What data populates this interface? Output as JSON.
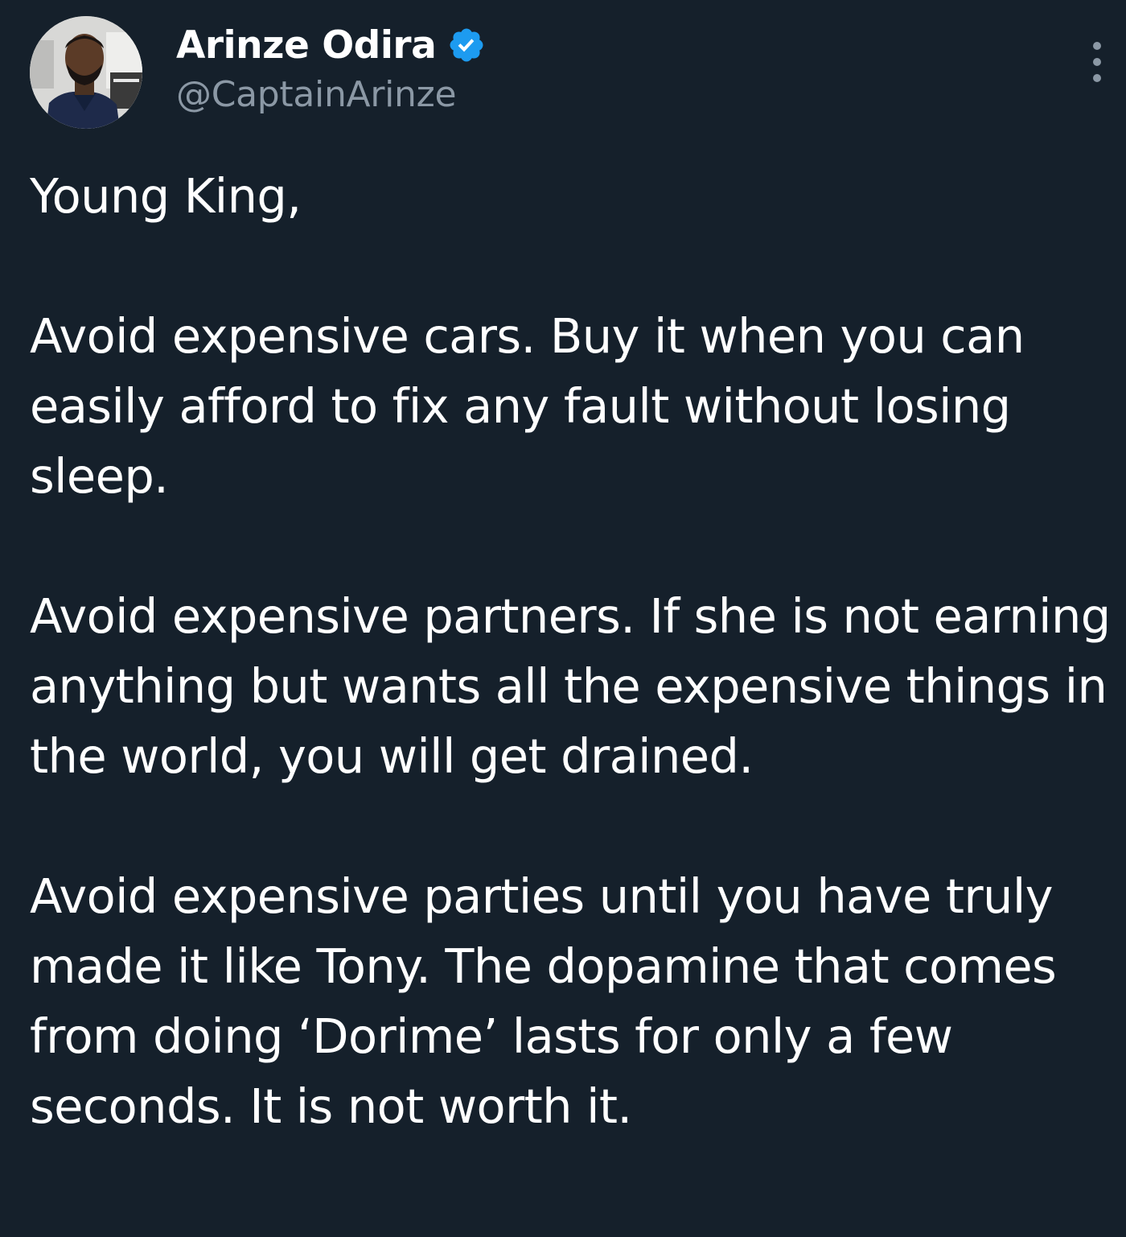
{
  "tweet": {
    "author": {
      "display_name": "Arinze Odira",
      "handle": "@CaptainArinze",
      "verified": true,
      "verified_color": "#1d9bf0",
      "avatar_icon": "profile-photo"
    },
    "more_icon": "vertical-ellipsis-icon",
    "paragraphs": [
      "Young King,",
      "Avoid expensive cars. Buy it when you can easily afford to fix any fault without losing sleep.",
      "Avoid expensive partners. If she is not earning anything but wants all the expensive things in the world, you will get drained.",
      "Avoid expensive parties until you have truly made it like Tony. The dopamine that comes from doing ‘Dorime’ lasts for only a few seconds. It is not worth it."
    ]
  },
  "theme": {
    "background": "#15202b",
    "text": "#ffffff",
    "secondary_text": "#8b98a5"
  }
}
